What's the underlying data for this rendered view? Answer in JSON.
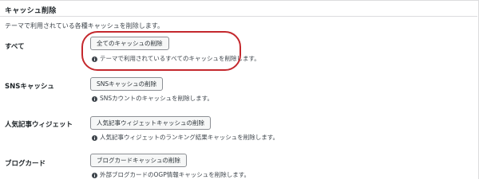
{
  "section": {
    "title": "キャッシュ削除",
    "description": "テーマで利用されている各種キャッシュを削除します。"
  },
  "rows": [
    {
      "label": "すべて",
      "button": "全てのキャッシュの削除",
      "note": "テーマで利用されているすべてのキャッシュを削除します。"
    },
    {
      "label": "SNSキャッシュ",
      "button": "SNSキャッシュの削除",
      "note": "SNSカウントのキャッシュを削除します。"
    },
    {
      "label": "人気記事ウィジェット",
      "button": "人気記事ウィジェットキャッシュの削除",
      "note": "人気記事ウィジェットのランキング結果キャッシュを削除します。"
    },
    {
      "label": "ブログカード",
      "button": "ブログカードキャッシュの削除",
      "note": "外部ブログカードのOGP情報キャッシュを削除します。"
    }
  ],
  "icons": {
    "note_icon": "info-icon"
  },
  "colors": {
    "highlight": "#c4282d",
    "button_bg": "#f6f7f7",
    "border": "#8c8f94"
  }
}
